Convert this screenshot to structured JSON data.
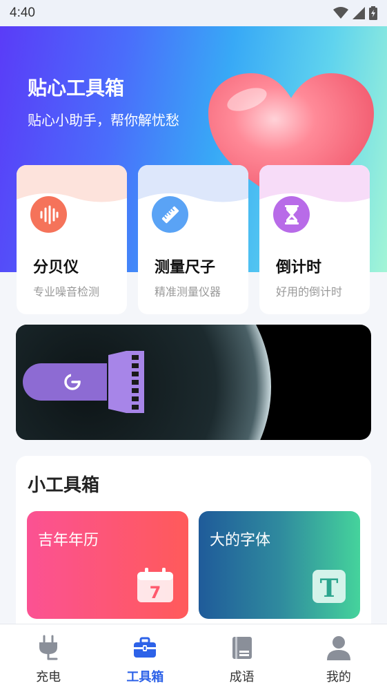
{
  "status_bar": {
    "time": "4:40"
  },
  "hero": {
    "title": "贴心工具箱",
    "subtitle": "贴心小助手，帮你解忧愁"
  },
  "tools": [
    {
      "name": "分贝仪",
      "desc": "专业噪音检测",
      "icon": "sound-wave-icon",
      "color": "#f5735a"
    },
    {
      "name": "测量尺子",
      "desc": "精准测量仪器",
      "icon": "ruler-icon",
      "color": "#5aa3f5"
    },
    {
      "name": "倒计时",
      "desc": "好用的倒计时",
      "icon": "hourglass-icon",
      "color": "#b86be8"
    }
  ],
  "toolbox": {
    "title": "小工具箱",
    "items": [
      {
        "label": "吉年年历",
        "icon": "calendar-icon",
        "icon_text": "7"
      },
      {
        "label": "大的字体",
        "icon": "font-icon",
        "icon_text": "T"
      }
    ]
  },
  "nav": {
    "items": [
      {
        "label": "充电",
        "icon": "plug-icon"
      },
      {
        "label": "工具箱",
        "icon": "toolbox-icon",
        "active": true
      },
      {
        "label": "成语",
        "icon": "book-icon"
      },
      {
        "label": "我的",
        "icon": "user-icon"
      }
    ]
  },
  "colors": {
    "accent": "#2d62e8",
    "nav_inactive": "#8a8f99"
  }
}
